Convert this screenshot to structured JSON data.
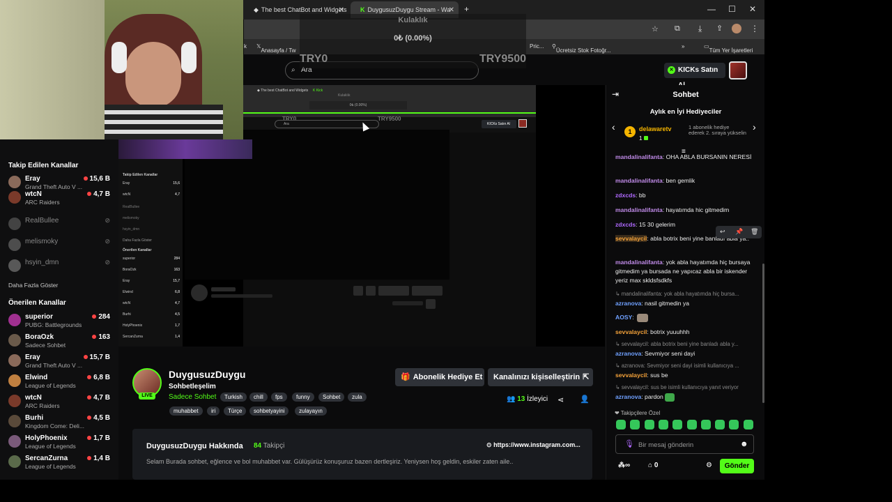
{
  "browser": {
    "tabs": [
      {
        "label": "The best ChatBot and Widgets"
      },
      {
        "label": "DuygusuzDuygu Stream - Wa"
      }
    ],
    "bookmarks": [
      "Anasayfa / Tw",
      "Pric...",
      "Ücretsiz Stok Fotoğr...",
      "Tüm Yer İşaretleri"
    ]
  },
  "overlay": {
    "label": "Kulaklık",
    "value": "0₺ (0.00%)",
    "min": "TRY0",
    "max": "TRY9500"
  },
  "header": {
    "search_placeholder": "Ara",
    "kicks_button": "KICKs Satın Al"
  },
  "sidebar": {
    "followed_title": "Takip Edilen Kanallar",
    "followed": [
      {
        "name": "Eray",
        "game": "Grand Theft Auto V ...",
        "viewers": "15,6 B",
        "live": true,
        "color": "#8a6a5a"
      },
      {
        "name": "wtcN",
        "game": "ARC Raiders",
        "viewers": "4,7 B",
        "live": true,
        "color": "#7a3a2a"
      },
      {
        "name": "RealBullee",
        "game": "",
        "viewers": "",
        "live": false,
        "color": "#666"
      },
      {
        "name": "melismoky",
        "game": "",
        "viewers": "",
        "live": false,
        "color": "#777"
      },
      {
        "name": "hsyin_dmn",
        "game": "",
        "viewers": "",
        "live": false,
        "color": "#888"
      }
    ],
    "show_more": "Daha Fazla Göster",
    "recommended_title": "Önerilen Kanallar",
    "recommended": [
      {
        "name": "superior",
        "game": "PUBG: Battlegrounds",
        "viewers": "284",
        "color": "#a03090"
      },
      {
        "name": "BoraOzk",
        "game": "Sadece Sohbet",
        "viewers": "163",
        "color": "#6a5a4a"
      },
      {
        "name": "Eray",
        "game": "Grand Theft Auto V ...",
        "viewers": "15,7 B",
        "color": "#8a6a5a"
      },
      {
        "name": "Elwind",
        "game": "League of Legends",
        "viewers": "6,8 B",
        "color": "#c08040"
      },
      {
        "name": "wtcN",
        "game": "ARC Raiders",
        "viewers": "4,7 B",
        "color": "#7a3a2a"
      },
      {
        "name": "Burhi",
        "game": "Kingdom Come: Deli...",
        "viewers": "4,5 B",
        "color": "#5a4a3a"
      },
      {
        "name": "HolyPhoenix",
        "game": "League of Legends",
        "viewers": "1,7 B",
        "color": "#7a5a7a"
      },
      {
        "name": "SercanZurna",
        "game": "League of Legends",
        "viewers": "1,4 B",
        "color": "#5a6a4a"
      }
    ]
  },
  "channel": {
    "name": "DuygusuzDuygu",
    "category": "Sohbetleşelim",
    "sub_category": "Sadece Sohbet",
    "live_badge": "LIVE",
    "tags": [
      "Turkish",
      "chill",
      "fps",
      "funny",
      "Sohbet",
      "zula",
      "muhabbet",
      "iri",
      "Türçe",
      "sohbetyayini",
      "zulayayın"
    ],
    "gift_button": "Abonelik Hediye Et",
    "customize_button": "Kanalınızı kişiselleştirin",
    "viewer_count": "13",
    "viewer_label": "İzleyici",
    "about_title": "DuygusuzDuygu Hakkında",
    "followers_count": "84",
    "followers_label": "Takipçi",
    "link": "https://www.instagram.com...",
    "description": "Selam Burada sohbet, eğlence ve bol muhabbet var. Gülüşürüz konuşuruz bazen dertleşiriz. Yeniysen hoş geldin, eskiler zaten aile.."
  },
  "chat": {
    "title": "Sohbet",
    "gifters_title": "Aylık en İyi Hediyeciler",
    "gifter": {
      "rank": "1",
      "name": "delawaretv",
      "count": "1",
      "note": "1 abonelik hediye ederek 2. sıraya yükselin"
    },
    "messages": [
      {
        "user": "mandalinalifanta",
        "color": "#c08be8",
        "text": ": OHA ABLA BURSANIN NERESİ"
      },
      {
        "user": "mandalinalifanta",
        "color": "#c08be8",
        "text": ": ben gemlik"
      },
      {
        "user": "zdxcds",
        "color": "#b06aff",
        "text": ": bb"
      },
      {
        "user": "mandalinalifanta",
        "color": "#c08be8",
        "text": ": hayatımda hic gitmedim"
      },
      {
        "user": "zdxcds",
        "color": "#b06aff",
        "text": ": 15 30 gelerim"
      },
      {
        "user": "sevvalaycil",
        "color": "#f4a23a",
        "text": ": abla botrix beni yine banladı abla ya.."
      },
      {
        "user": "mandalinalifanta",
        "color": "#c08be8",
        "text": ": yok abla hayatımda hiç bursaya gitmedim ya bursada ne yapıcaz abla bir iskender yeriz max skldsfsdkfs"
      },
      {
        "user": "azranova",
        "color": "#6fa0ff",
        "text": ": nasil gitmedin ya"
      },
      {
        "user": "AOSY",
        "color": "#6fa0ff",
        "text": ":"
      },
      {
        "user": "sevvalaycil",
        "color": "#f4a23a",
        "text": ": botrix yuuuhhh"
      },
      {
        "user": "azranova",
        "color": "#6fa0ff",
        "text": ": Sevmiyor seni dayi"
      },
      {
        "user": "sevvalaycil",
        "color": "#f4a23a",
        "text": ": sus be"
      },
      {
        "user": "azranova",
        "color": "#6fa0ff",
        "text": ": pardon"
      }
    ],
    "replies": [
      "mandalinalifanta: yok abla hayatımda hiç bursa...",
      "sevvalaycil: abla botrix beni yine banladı abla y...",
      "azranova: Sevmiyor seni dayi isimli kullanıcıya ...",
      "sevvalaycil: sus be isimli kullanıcıya yanıt veriyor"
    ],
    "followers_only": "Takipçilere Özel",
    "input_placeholder": "Bir mesaj gönderin",
    "kicks_count": "0",
    "send_button": "Gönder"
  }
}
